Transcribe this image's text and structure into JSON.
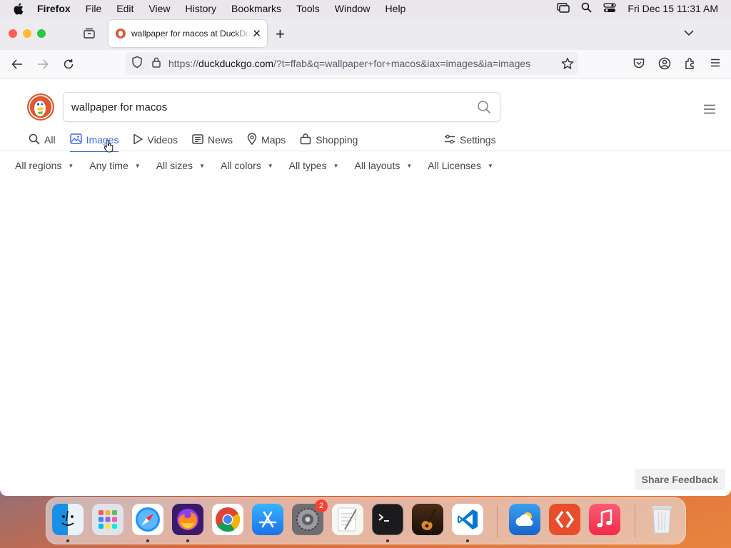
{
  "menubar": {
    "app_name": "Firefox",
    "items": [
      "File",
      "Edit",
      "View",
      "History",
      "Bookmarks",
      "Tools",
      "Window",
      "Help"
    ],
    "clock": "Fri Dec 15  11:31 AM"
  },
  "browser": {
    "tab_title": "wallpaper for macos at DuckDuckGo",
    "url_prefix": "https://",
    "url_domain": "duckduckgo.com",
    "url_rest": "/?t=ffab&q=wallpaper+for+macos&iax=images&ia=images"
  },
  "search": {
    "query": "wallpaper for macos"
  },
  "page_tabs": [
    {
      "label": "All",
      "icon": "search-icon"
    },
    {
      "label": "Images",
      "icon": "image-icon",
      "active": true
    },
    {
      "label": "Videos",
      "icon": "play-icon"
    },
    {
      "label": "News",
      "icon": "news-icon"
    },
    {
      "label": "Maps",
      "icon": "map-pin-icon"
    },
    {
      "label": "Shopping",
      "icon": "shopping-bag-icon"
    }
  ],
  "settings_label": "Settings",
  "filters": [
    "All regions",
    "Any time",
    "All sizes",
    "All colors",
    "All types",
    "All layouts",
    "All Licenses"
  ],
  "feedback_label": "Share Feedback",
  "dock": {
    "system_settings_badge": "2"
  }
}
